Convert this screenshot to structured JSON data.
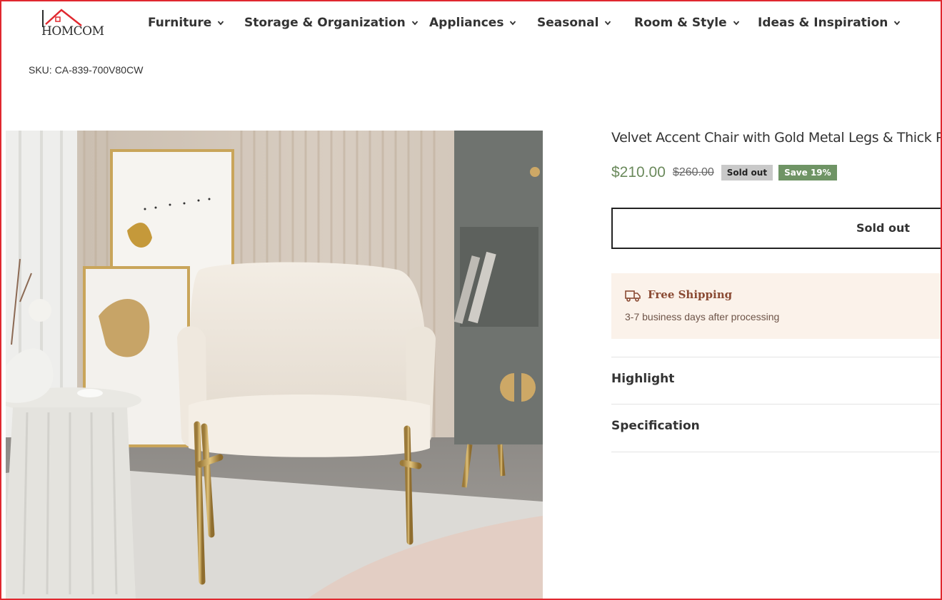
{
  "brand": {
    "logo_text": "HOMCOM",
    "accent": "#e0282f"
  },
  "nav": [
    {
      "label": "Furniture"
    },
    {
      "label": "Storage & Organization"
    },
    {
      "label": "Appliances"
    },
    {
      "label": "Seasonal"
    },
    {
      "label": "Room & Style"
    },
    {
      "label": "Ideas & Inspiration"
    }
  ],
  "sku": {
    "label": "SKU:",
    "value": "CA-839-700V80CW"
  },
  "product": {
    "title": "Velvet Accent Chair with Gold Metal Legs & Thick Padded Seat",
    "price": "$210.00",
    "compare_price": "$260.00",
    "badge_sold": "Sold out",
    "badge_save": "Save 19%",
    "sold_button": "Sold out",
    "price_color": "#6b8a5c"
  },
  "shipping": {
    "icon": "truck-icon",
    "title": "Free Shipping",
    "subtitle": "3-7 business days after processing"
  },
  "accordion": [
    {
      "label": "Highlight"
    },
    {
      "label": "Specification"
    }
  ]
}
